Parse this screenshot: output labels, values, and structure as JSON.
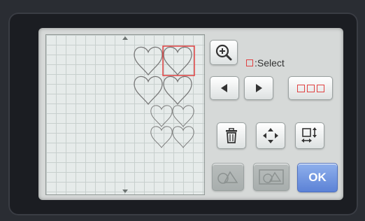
{
  "select_label": ":Select",
  "buttons": {
    "ok": "OK"
  },
  "colors": {
    "accent_red": "#e04040",
    "ok_blue": "#5c82d6"
  },
  "icons": [
    "zoom-in-icon",
    "arrow-left-icon",
    "arrow-right-icon",
    "select-all-icon",
    "delete-icon",
    "move-icon",
    "resize-icon",
    "shape-cut-icon",
    "shape-draw-icon"
  ]
}
